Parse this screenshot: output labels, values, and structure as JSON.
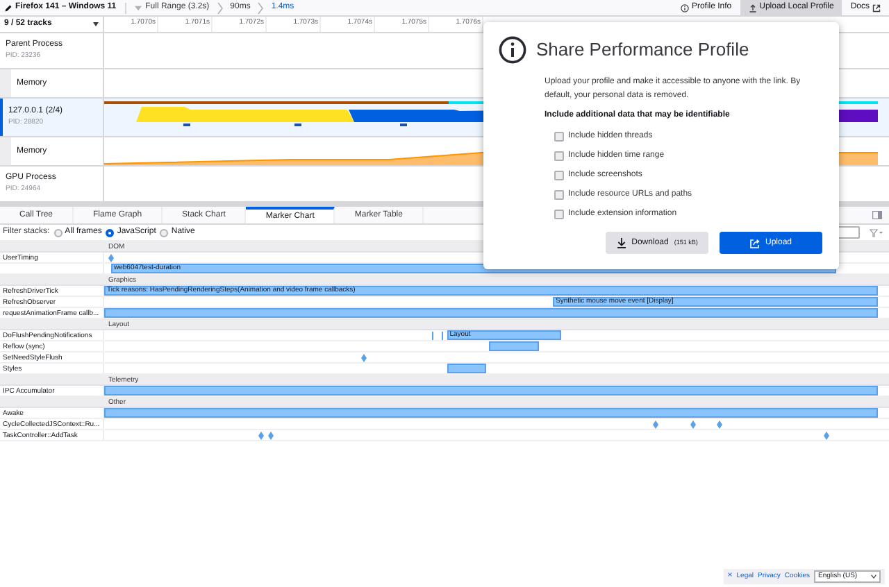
{
  "top_bar": {
    "profile_name": "Firefox 141 – Windows 11",
    "breadcrumbs": [
      {
        "label": "Full Range (3.2s)",
        "selected": false
      },
      {
        "label": "90ms",
        "selected": false
      },
      {
        "label": "1.4ms",
        "selected": true
      }
    ],
    "buttons": [
      {
        "label": "Profile Info",
        "kind": "info",
        "selected": false
      },
      {
        "label": "Upload Local Profile",
        "kind": "upload",
        "selected": true
      },
      {
        "label": "Docs",
        "kind": "docs",
        "selected": false
      }
    ]
  },
  "timeline": {
    "track_count": "9 / 52 tracks",
    "ticks": [
      "1.7070s",
      "1.7071s",
      "1.7072s",
      "1.7073s",
      "1.7074s",
      "1.7075s",
      "1.7076s"
    ],
    "tracks": [
      {
        "kind": "process",
        "name": "Parent Process",
        "pid": "PID: 23236",
        "selected": false
      },
      {
        "kind": "memory",
        "name": "Memory",
        "selected": false
      },
      {
        "kind": "thread",
        "name": "127.0.0.1 (2/4)",
        "pid": "PID: 28820",
        "selected": true
      },
      {
        "kind": "memory",
        "name": "Memory",
        "selected": false
      },
      {
        "kind": "process",
        "name": "GPU Process",
        "pid": "PID: 24964",
        "selected": false
      }
    ]
  },
  "tabs": [
    {
      "label": "Call Tree",
      "selected": false
    },
    {
      "label": "Flame Graph",
      "selected": false
    },
    {
      "label": "Stack Chart",
      "selected": false
    },
    {
      "label": "Marker Chart",
      "selected": true
    },
    {
      "label": "Marker Table",
      "selected": false
    }
  ],
  "filter": {
    "label": "Filter stacks:",
    "options": [
      {
        "label": "All frames",
        "selected": false
      },
      {
        "label": "JavaScript",
        "selected": true
      },
      {
        "label": "Native",
        "selected": false
      }
    ]
  },
  "marker_chart": {
    "rows": [
      {
        "kind": "header",
        "label": "DOM"
      },
      {
        "kind": "row",
        "label": "UserTiming"
      },
      {
        "kind": "row",
        "bar_label": "web6047test-duration"
      },
      {
        "kind": "header",
        "label": "Graphics"
      },
      {
        "kind": "row",
        "label": "RefreshDriverTick",
        "bar_label": "Tick reasons: HasPendingRenderingSteps(Animation and video frame callbacks)"
      },
      {
        "kind": "row",
        "label": "RefreshObserver",
        "bar_label": "Synthetic mouse move event [Display]"
      },
      {
        "kind": "row",
        "label": "requestAnimationFrame callb..."
      },
      {
        "kind": "header",
        "label": "Layout"
      },
      {
        "kind": "row",
        "label": "DoFlushPendingNotifications",
        "bar_label": "Layout"
      },
      {
        "kind": "row",
        "label": "Reflow (sync)"
      },
      {
        "kind": "row",
        "label": "SetNeedStyleFlush"
      },
      {
        "kind": "row",
        "label": "Styles"
      },
      {
        "kind": "header",
        "label": "Telemetry"
      },
      {
        "kind": "row",
        "label": "IPC Accumulator"
      },
      {
        "kind": "header",
        "label": "Other"
      },
      {
        "kind": "row",
        "label": "Awake"
      },
      {
        "kind": "row",
        "label": "CycleCollectedJSContext::Ru..."
      },
      {
        "kind": "row",
        "label": "TaskController::AddTask"
      }
    ]
  },
  "share_panel": {
    "title": "Share Performance Profile",
    "description": "Upload your profile and make it accessible to anyone with the link. By default, your personal data is removed.",
    "options_heading": "Include additional data that may be identifiable",
    "options": [
      {
        "label": "Include hidden threads",
        "checked": false
      },
      {
        "label": "Include hidden time range",
        "checked": false
      },
      {
        "label": "Include screenshots",
        "checked": false
      },
      {
        "label": "Include resource URLs and paths",
        "checked": false
      },
      {
        "label": "Include extension information",
        "checked": false
      }
    ],
    "download": {
      "label": "Download",
      "size": "(151 kB)"
    },
    "upload": {
      "label": "Upload"
    }
  },
  "footer": {
    "close": "×",
    "links": [
      "Legal",
      "Privacy",
      "Cookies"
    ],
    "language": "English (US)"
  }
}
